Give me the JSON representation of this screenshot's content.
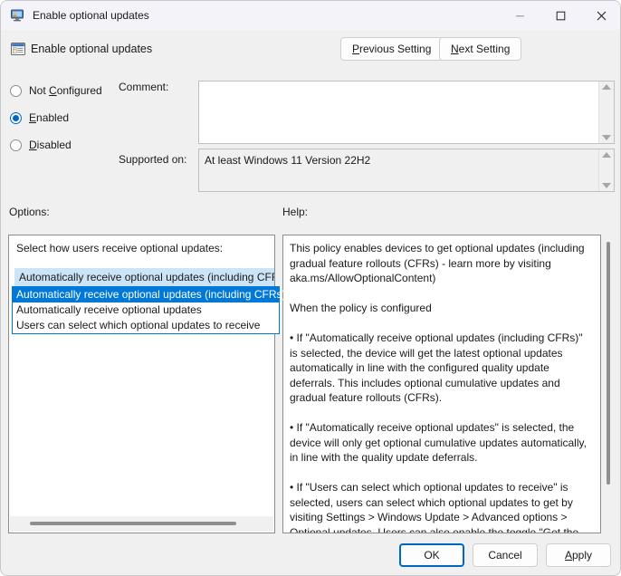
{
  "window": {
    "title": "Enable optional updates",
    "icon": "computer-policy-icon",
    "controls": {
      "minimize": "—",
      "maximize": "☐",
      "close": "✕"
    }
  },
  "header": {
    "icon": "policy-setting-icon",
    "title": "Enable optional updates",
    "previous_setting": "Previous Setting",
    "previous_mnemonic": "P",
    "next_setting": "Next Setting",
    "next_mnemonic": "N"
  },
  "state_options": [
    {
      "label": "Not Configured",
      "mnemonic": "C",
      "selected": false
    },
    {
      "label": "Enabled",
      "mnemonic": "E",
      "selected": true
    },
    {
      "label": "Disabled",
      "mnemonic": "D",
      "selected": false
    }
  ],
  "comment": {
    "label": "Comment:",
    "value": "",
    "placeholder": ""
  },
  "supported_on": {
    "label": "Supported on:",
    "value": "At least Windows 11 Version 22H2"
  },
  "options": {
    "label": "Options:",
    "combo_caption": "Select how users receive optional updates:",
    "selected_value": "Automatically receive optional updates (including CFRs)",
    "dropdown_open": true,
    "dropdown_items": [
      "Automatically receive optional updates (including CFRs)",
      "Automatically receive optional updates",
      "Users can select which optional updates to receive"
    ],
    "selected_index": 0
  },
  "help": {
    "label": "Help:",
    "text": "This policy enables devices to get optional updates (including gradual feature rollouts (CFRs) - learn more by visiting aka.ms/AllowOptionalContent)\n\nWhen the policy is configured\n\n• If \"Automatically receive optional updates (including CFRs)\" is selected, the device will get the latest optional updates automatically in line with the configured quality update deferrals. This includes optional cumulative updates and gradual feature rollouts (CFRs).\n\n• If \"Automatically receive optional updates\" is selected, the device will only get optional cumulative updates automatically, in line with the quality update deferrals.\n\n• If \"Users can select which optional updates to receive\" is selected, users can select which optional updates to get by visiting Settings > Windows Update > Advanced options > Optional updates. Users can also enable the toggle \"Get the latest updates as soon as they're available\" to automatically receive"
  },
  "footer": {
    "ok": "OK",
    "cancel": "Cancel",
    "apply": "Apply",
    "apply_mnemonic": "A"
  },
  "colors": {
    "accent": "#0078d7",
    "radio_accent": "#0067c0",
    "combo_selection": "#cce4f7",
    "window_bg": "#f0f0f0",
    "titlebar_bg": "#f3f3f9"
  }
}
